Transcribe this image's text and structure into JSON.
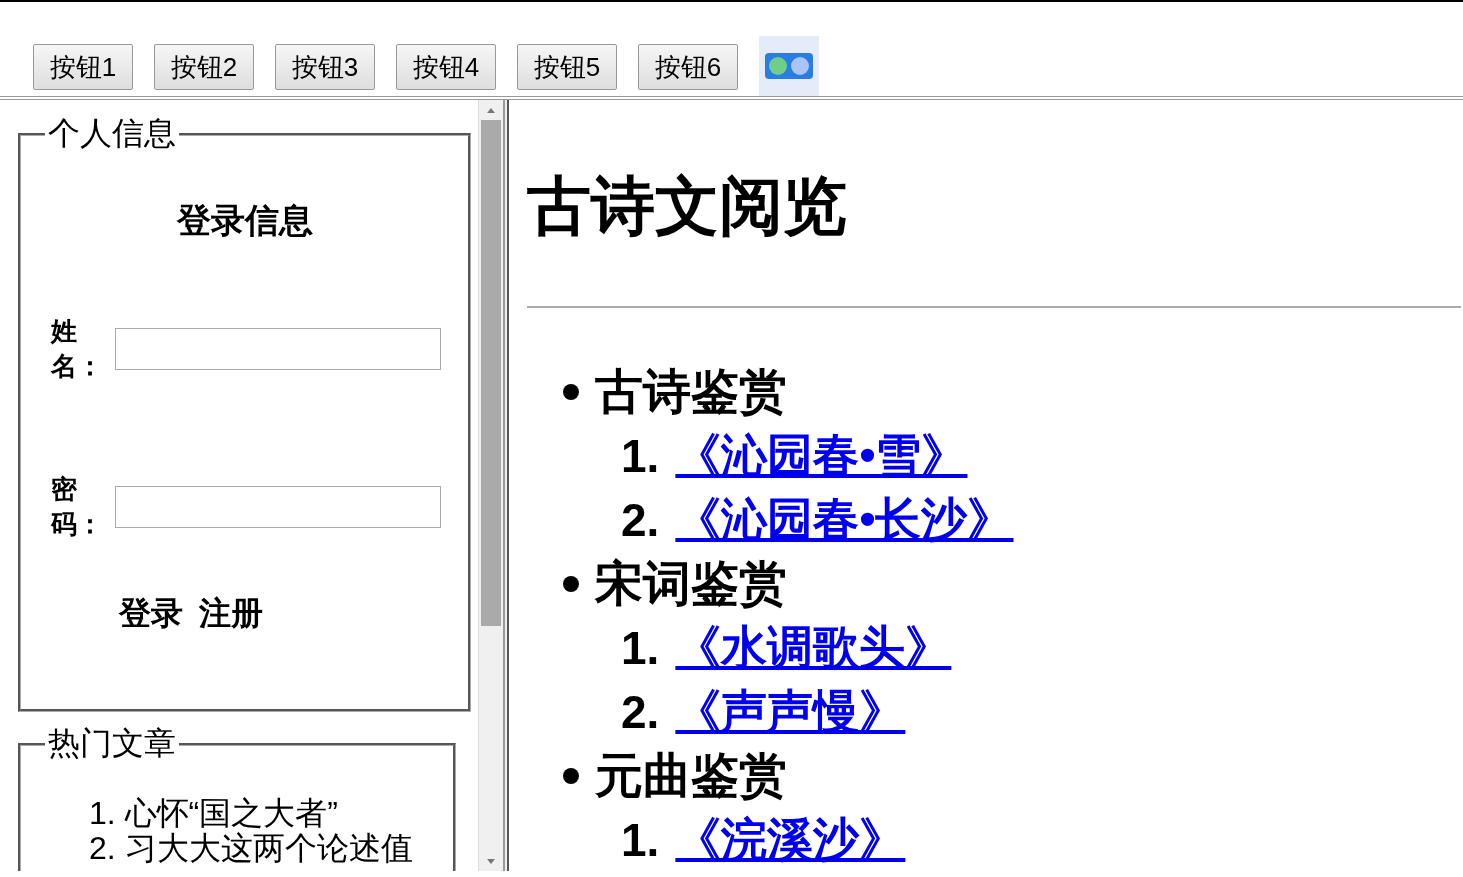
{
  "toolbar": {
    "buttons": [
      "按钮1",
      "按钮2",
      "按钮3",
      "按钮4",
      "按钮5",
      "按钮6"
    ]
  },
  "left_panel": {
    "personal_info": {
      "legend": "个人信息",
      "heading": "登录信息",
      "fields": [
        {
          "label": "姓名："
        },
        {
          "label": "密码："
        }
      ],
      "actions": [
        "登录",
        "注册"
      ]
    },
    "hot_articles": {
      "legend": "热门文章",
      "items": [
        {
          "number": "1.",
          "text": "心怀“国之大者”"
        },
        {
          "number": "2.",
          "text": "习大大这两个论述值"
        }
      ]
    }
  },
  "main": {
    "title": "古诗文阅览",
    "sections": [
      {
        "title": "古诗鉴赏",
        "items": [
          {
            "number": "1.",
            "title": "《沁园春•雪》"
          },
          {
            "number": "2.",
            "title": "《沁园春•长沙》"
          }
        ]
      },
      {
        "title": "宋词鉴赏",
        "items": [
          {
            "number": "1.",
            "title": "《水调歌头》"
          },
          {
            "number": "2.",
            "title": "《声声慢》"
          }
        ]
      },
      {
        "title": "元曲鉴赏",
        "items": [
          {
            "number": "1.",
            "title": "《浣溪沙》"
          }
        ]
      }
    ]
  }
}
